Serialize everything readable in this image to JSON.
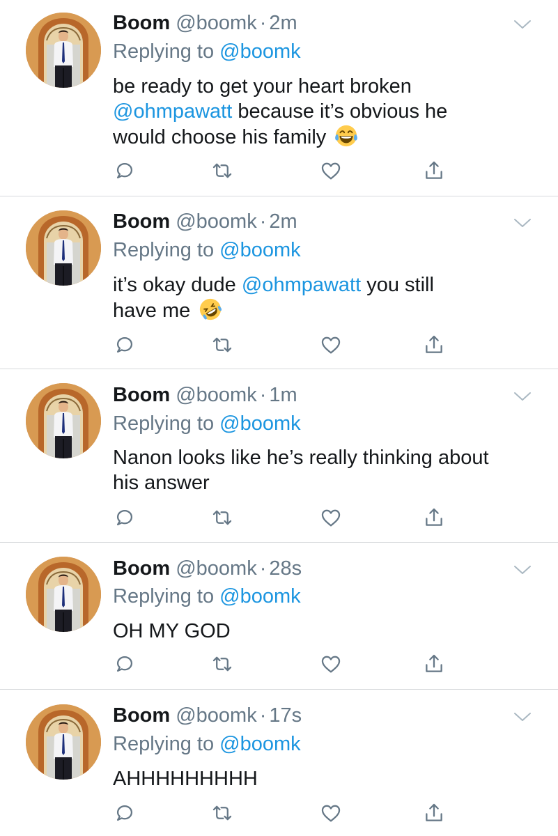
{
  "colors": {
    "text": "#14171a",
    "secondary": "#657786",
    "link": "#1b95e0",
    "divider": "#d6d9dc",
    "icon": "#657786"
  },
  "tweets": [
    {
      "name": "Boom",
      "handle": "@boomk",
      "dot": "·",
      "time": "2m",
      "reply_prefix": "Replying to",
      "reply_to": "@boomk",
      "lines": [
        [
          {
            "t": "be ready to get your heart broken"
          }
        ],
        [
          {
            "t": "@ohmpawatt",
            "mention": true
          },
          {
            "t": " because it’s obvious he"
          }
        ],
        [
          {
            "t": "would choose his family "
          },
          {
            "emoji": "face-with-tears-of-joy-emoji"
          }
        ]
      ]
    },
    {
      "name": "Boom",
      "handle": "@boomk",
      "dot": "·",
      "time": "2m",
      "reply_prefix": "Replying to",
      "reply_to": "@boomk",
      "lines": [
        [
          {
            "t": "it’s okay dude "
          },
          {
            "t": "@ohmpawatt",
            "mention": true
          },
          {
            "t": " you still"
          }
        ],
        [
          {
            "t": "have me "
          },
          {
            "emoji": "rolling-on-floor-laughing-emoji"
          }
        ]
      ]
    },
    {
      "name": "Boom",
      "handle": "@boomk",
      "dot": "·",
      "time": "1m",
      "reply_prefix": "Replying to",
      "reply_to": "@boomk",
      "lines": [
        [
          {
            "t": "Nanon looks like he’s really thinking about"
          }
        ],
        [
          {
            "t": "his answer"
          }
        ]
      ]
    },
    {
      "name": "Boom",
      "handle": "@boomk",
      "dot": "·",
      "time": "28s",
      "reply_prefix": "Replying to",
      "reply_to": "@boomk",
      "lines": [
        [
          {
            "t": "OH MY GOD"
          }
        ]
      ]
    },
    {
      "name": "Boom",
      "handle": "@boomk",
      "dot": "·",
      "time": "17s",
      "reply_prefix": "Replying to",
      "reply_to": "@boomk",
      "lines": [
        [
          {
            "t": "AHHHHHHHHH"
          }
        ]
      ]
    }
  ],
  "action_icons": [
    "reply-icon",
    "retweet-icon",
    "like-icon",
    "share-icon"
  ],
  "menu_icon": "chevron-down-icon"
}
